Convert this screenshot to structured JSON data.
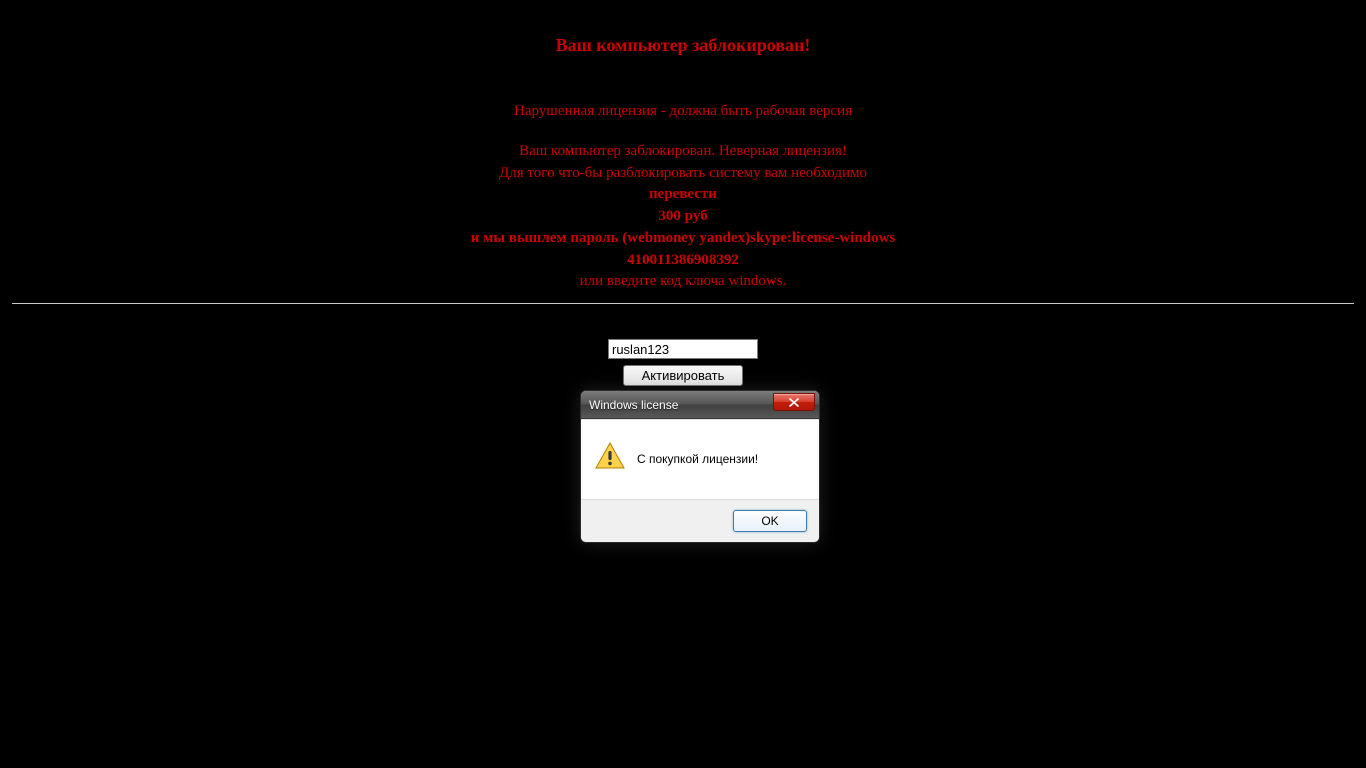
{
  "headline": "Ваш компьютер заблокирован!",
  "lines": {
    "l1": "Нарушенная лицензия - должна быть рабочая версия",
    "l2": "Ваш компьютер заблокирован. Неверная лицензия!",
    "l3": "Для того что-бы разблокировать систему вам необходимо",
    "l4": "перевести",
    "l5": "300 руб",
    "l6": "и мы вышлем пароль (webmoney yandex)skype:license-windows",
    "l7": "410011386908392",
    "l8": "или введите код ключа windows."
  },
  "form": {
    "code_value": "ruslan123",
    "activate_label": "Активировать"
  },
  "dialog": {
    "title": "Windows license",
    "message": "С покупкой лицензии!",
    "ok_label": "OK"
  }
}
